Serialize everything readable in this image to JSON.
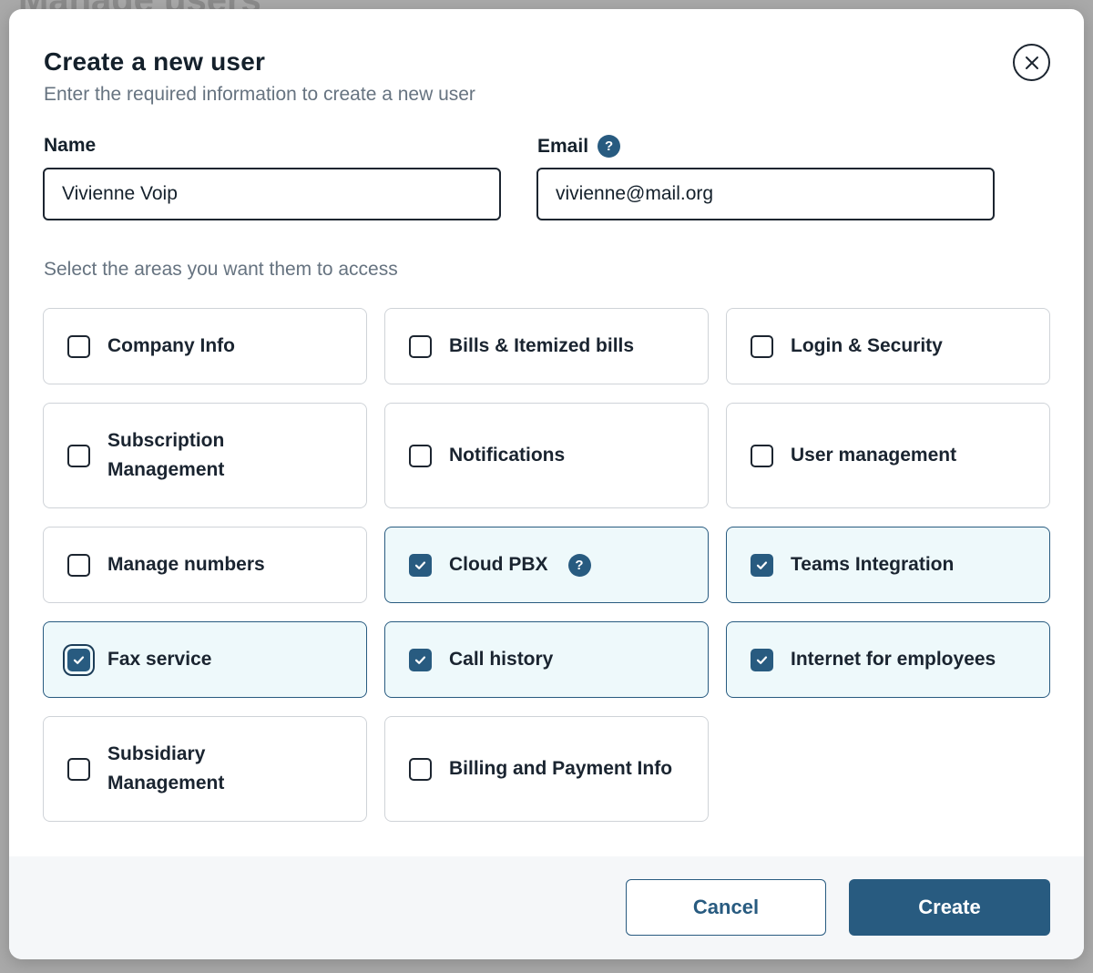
{
  "background": {
    "heading": "Manage users"
  },
  "modal": {
    "title": "Create a new user",
    "subtitle": "Enter the required information to create a new user"
  },
  "form": {
    "name": {
      "label": "Name",
      "value": "Vivienne Voip"
    },
    "email": {
      "label": "Email",
      "value": "vivienne@mail.org",
      "help": "?"
    }
  },
  "access": {
    "label": "Select the areas you want them to access",
    "options": [
      {
        "line1": "Company Info",
        "line2": "",
        "checked": false
      },
      {
        "line1": "Bills & Itemized bills",
        "line2": "",
        "checked": false
      },
      {
        "line1": "Login & Security",
        "line2": "",
        "checked": false
      },
      {
        "line1": "Subscription",
        "line2": "Management",
        "checked": false
      },
      {
        "line1": "Notifications",
        "line2": "",
        "checked": false
      },
      {
        "line1": "User management",
        "line2": "",
        "checked": false
      },
      {
        "line1": "Manage numbers",
        "line2": "",
        "checked": false
      },
      {
        "line1": "Cloud PBX",
        "line2": "",
        "checked": true,
        "help": "?"
      },
      {
        "line1": "Teams Integration",
        "line2": "",
        "checked": true
      },
      {
        "line1": "Fax service",
        "line2": "",
        "checked": true,
        "focused": true
      },
      {
        "line1": "Call history",
        "line2": "",
        "checked": true
      },
      {
        "line1": "Internet for employees",
        "line2": "",
        "checked": true
      },
      {
        "line1": "Subsidiary",
        "line2": "Management",
        "checked": false
      },
      {
        "line1": "Billing and Payment Info",
        "line2": "",
        "checked": false
      }
    ]
  },
  "footer": {
    "cancel": "Cancel",
    "create": "Create"
  },
  "colors": {
    "accent": "#285b80",
    "checked_bg": "#eef9fb",
    "text": "#14202b",
    "muted": "#667380"
  }
}
